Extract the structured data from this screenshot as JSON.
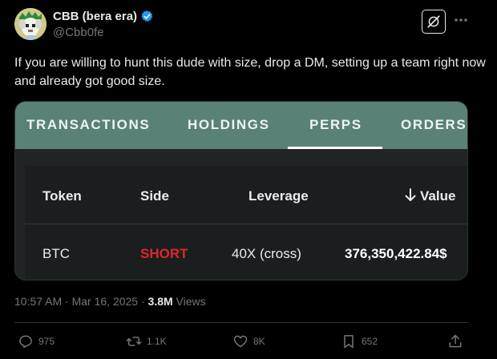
{
  "header": {
    "display_name": "CBB (bera era)",
    "handle": "@Cbb0fe",
    "avatar_icon": "avatar-pixel-art",
    "verified_color": "#1d9bf0"
  },
  "tweet": {
    "text": "If you are willing to hunt this dude with size, drop a DM, setting up a team right now and already got good size."
  },
  "card": {
    "tabs": [
      {
        "label": "TRANSACTIONS"
      },
      {
        "label": "HOLDINGS"
      },
      {
        "label": "PERPS",
        "active": true
      },
      {
        "label": "ORDERS"
      }
    ],
    "columns": [
      "Token",
      "Side",
      "Leverage",
      "Value"
    ],
    "rows": [
      {
        "token": "BTC",
        "side": "SHORT",
        "leverage": "40X (cross)",
        "value": "376,350,422.84$"
      }
    ],
    "header_bg": "#5a8176",
    "short_color": "#e0262b"
  },
  "meta": {
    "time": "10:57 AM · Mar 16, 2025 ·",
    "views_count": "3.8M",
    "views_label": "Views"
  },
  "actions": {
    "replies": "975",
    "reposts": "1.1K",
    "likes": "8K",
    "bookmarks": "652"
  }
}
